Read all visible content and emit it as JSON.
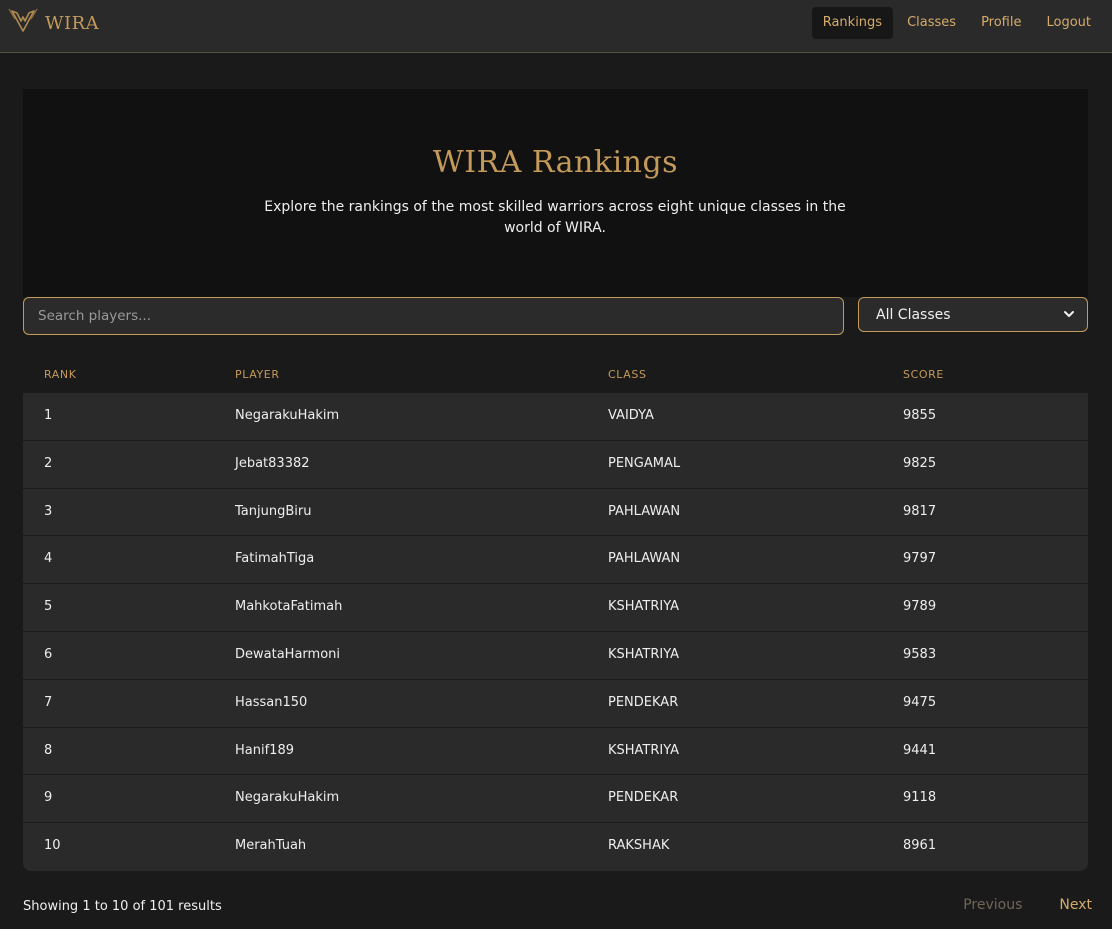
{
  "brand": {
    "name": "WIRA",
    "icon": "wings-logo-icon"
  },
  "nav": {
    "items": [
      {
        "label": "Rankings",
        "active": true
      },
      {
        "label": "Classes",
        "active": false
      },
      {
        "label": "Profile",
        "active": false
      },
      {
        "label": "Logout",
        "active": false
      }
    ]
  },
  "hero": {
    "title": "WIRA Rankings",
    "subtitle": "Explore the rankings of the most skilled warriors across eight unique classes in the world of WIRA."
  },
  "filters": {
    "search_placeholder": "Search players...",
    "search_value": "",
    "class_selected": "All Classes"
  },
  "table": {
    "columns": [
      "Rank",
      "Player",
      "Class",
      "Score"
    ],
    "rows": [
      {
        "rank": "1",
        "player": "NegarakuHakim",
        "class": "VAIDYA",
        "score": "9855"
      },
      {
        "rank": "2",
        "player": "Jebat83382",
        "class": "PENGAMAL",
        "score": "9825"
      },
      {
        "rank": "3",
        "player": "TanjungBiru",
        "class": "PAHLAWAN",
        "score": "9817"
      },
      {
        "rank": "4",
        "player": "FatimahTiga",
        "class": "PAHLAWAN",
        "score": "9797"
      },
      {
        "rank": "5",
        "player": "MahkotaFatimah",
        "class": "KSHATRIYA",
        "score": "9789"
      },
      {
        "rank": "6",
        "player": "DewataHarmoni",
        "class": "KSHATRIYA",
        "score": "9583"
      },
      {
        "rank": "7",
        "player": "Hassan150",
        "class": "PENDEKAR",
        "score": "9475"
      },
      {
        "rank": "8",
        "player": "Hanif189",
        "class": "KSHATRIYA",
        "score": "9441"
      },
      {
        "rank": "9",
        "player": "NegarakuHakim",
        "class": "PENDEKAR",
        "score": "9118"
      },
      {
        "rank": "10",
        "player": "MerahTuah",
        "class": "RAKSHAK",
        "score": "8961"
      }
    ]
  },
  "pagination": {
    "summary": "Showing 1 to 10 of 101 results",
    "previous_label": "Previous",
    "next_label": "Next",
    "previous_enabled": false,
    "next_enabled": true
  },
  "colors": {
    "accent": "#c49a5b",
    "navbar_bg": "#2a2a2a",
    "page_bg": "#1a1a1a",
    "hero_bg": "#111111",
    "row_bg": "#2a2a2a"
  }
}
